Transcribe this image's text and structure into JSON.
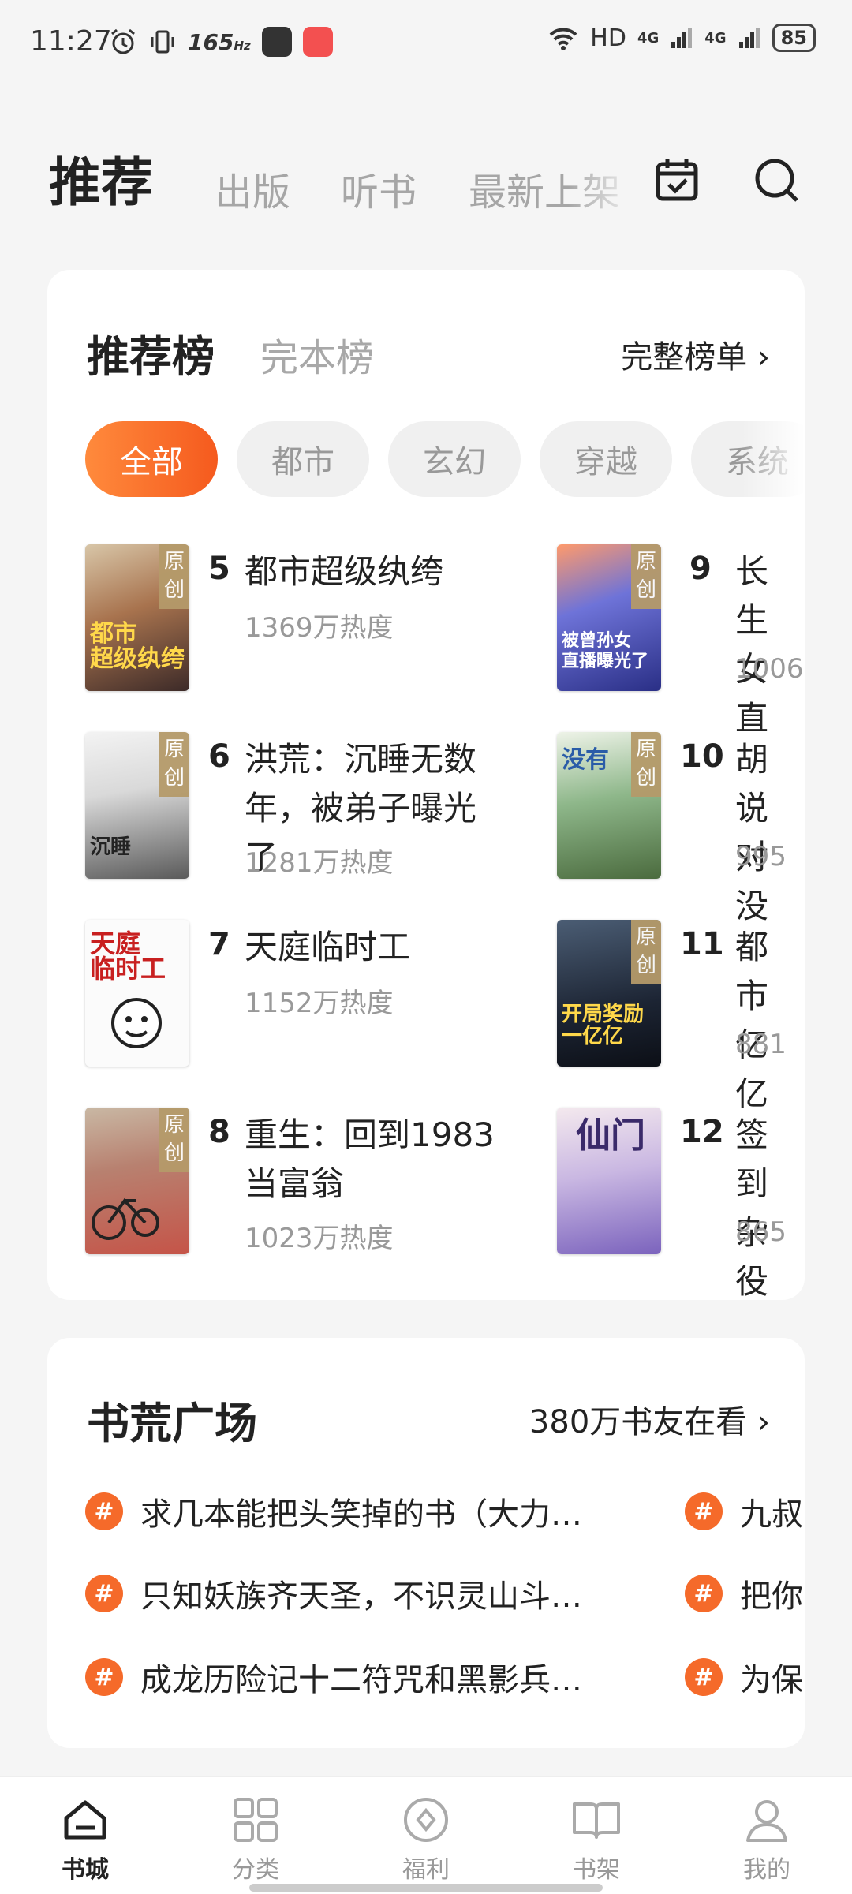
{
  "status": {
    "time": "11:27",
    "refresh": "165",
    "refresh_unit": "Hz",
    "network": "HD",
    "sig1": "4G",
    "sig2": "4G",
    "battery": "85"
  },
  "topnav": {
    "tabs": [
      "推荐",
      "出版",
      "听书",
      "最新上架"
    ],
    "icons": [
      "calendar-check-icon",
      "search-icon"
    ]
  },
  "ranking": {
    "tab_active": "推荐榜",
    "tab_other": "完本榜",
    "link": "完整榜单",
    "chips": [
      "全部",
      "都市",
      "玄幻",
      "穿越",
      "系统"
    ],
    "books_left": [
      {
        "rank": "5",
        "title": "都市超级纨绔",
        "heat": "1369万热度",
        "tag": "原创",
        "cover": "都市\n超级纨绔"
      },
      {
        "rank": "6",
        "title": "洪荒：沉睡无数年，被弟子曝光了",
        "heat": "1281万热度",
        "tag": "原创",
        "cover": "沉睡"
      },
      {
        "rank": "7",
        "title": "天庭临时工",
        "heat": "1152万热度",
        "tag": "",
        "cover": "天庭\n临时工"
      },
      {
        "rank": "8",
        "title": "重生：回到1983当富翁",
        "heat": "1023万热度",
        "tag": "原创",
        "cover": ""
      }
    ],
    "books_right": [
      {
        "rank": "9",
        "title": "长生女直",
        "heat": "1006",
        "tag": "原创",
        "cover": "被曾孙女\n直播曝光了"
      },
      {
        "rank": "10",
        "title": "胡说对没",
        "heat": "995",
        "tag": "原创",
        "cover": "没有"
      },
      {
        "rank": "11",
        "title": "都市亿亿",
        "heat": "881",
        "tag": "原创",
        "cover": "开局奖励\n一亿亿"
      },
      {
        "rank": "12",
        "title": "签到杂役",
        "heat": "865",
        "tag": "",
        "cover": "仙门"
      }
    ]
  },
  "square": {
    "title": "书荒广场",
    "link": "380万书友在看",
    "topics_left": [
      "求几本能把头笑掉的书（大力…",
      "只知妖族齐天圣，不识灵山斗…",
      "成龙历险记十二符咒和黑影兵…"
    ],
    "topics_right": [
      "九叔",
      "把你",
      "为保"
    ]
  },
  "bottomnav": {
    "items": [
      "书城",
      "分类",
      "福利",
      "书架",
      "我的"
    ]
  }
}
